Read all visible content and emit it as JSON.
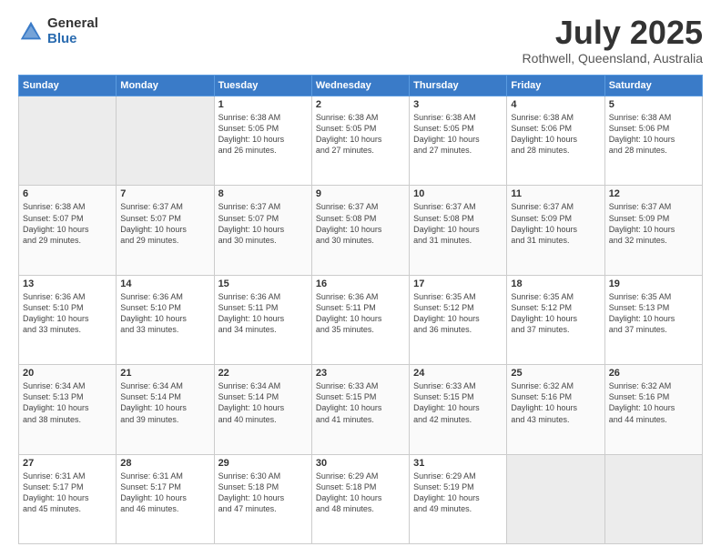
{
  "header": {
    "logo_general": "General",
    "logo_blue": "Blue",
    "month_title": "July 2025",
    "location": "Rothwell, Queensland, Australia"
  },
  "days_of_week": [
    "Sunday",
    "Monday",
    "Tuesday",
    "Wednesday",
    "Thursday",
    "Friday",
    "Saturday"
  ],
  "weeks": [
    [
      {
        "day": "",
        "info": ""
      },
      {
        "day": "",
        "info": ""
      },
      {
        "day": "1",
        "info": "Sunrise: 6:38 AM\nSunset: 5:05 PM\nDaylight: 10 hours\nand 26 minutes."
      },
      {
        "day": "2",
        "info": "Sunrise: 6:38 AM\nSunset: 5:05 PM\nDaylight: 10 hours\nand 27 minutes."
      },
      {
        "day": "3",
        "info": "Sunrise: 6:38 AM\nSunset: 5:05 PM\nDaylight: 10 hours\nand 27 minutes."
      },
      {
        "day": "4",
        "info": "Sunrise: 6:38 AM\nSunset: 5:06 PM\nDaylight: 10 hours\nand 28 minutes."
      },
      {
        "day": "5",
        "info": "Sunrise: 6:38 AM\nSunset: 5:06 PM\nDaylight: 10 hours\nand 28 minutes."
      }
    ],
    [
      {
        "day": "6",
        "info": "Sunrise: 6:38 AM\nSunset: 5:07 PM\nDaylight: 10 hours\nand 29 minutes."
      },
      {
        "day": "7",
        "info": "Sunrise: 6:37 AM\nSunset: 5:07 PM\nDaylight: 10 hours\nand 29 minutes."
      },
      {
        "day": "8",
        "info": "Sunrise: 6:37 AM\nSunset: 5:07 PM\nDaylight: 10 hours\nand 30 minutes."
      },
      {
        "day": "9",
        "info": "Sunrise: 6:37 AM\nSunset: 5:08 PM\nDaylight: 10 hours\nand 30 minutes."
      },
      {
        "day": "10",
        "info": "Sunrise: 6:37 AM\nSunset: 5:08 PM\nDaylight: 10 hours\nand 31 minutes."
      },
      {
        "day": "11",
        "info": "Sunrise: 6:37 AM\nSunset: 5:09 PM\nDaylight: 10 hours\nand 31 minutes."
      },
      {
        "day": "12",
        "info": "Sunrise: 6:37 AM\nSunset: 5:09 PM\nDaylight: 10 hours\nand 32 minutes."
      }
    ],
    [
      {
        "day": "13",
        "info": "Sunrise: 6:36 AM\nSunset: 5:10 PM\nDaylight: 10 hours\nand 33 minutes."
      },
      {
        "day": "14",
        "info": "Sunrise: 6:36 AM\nSunset: 5:10 PM\nDaylight: 10 hours\nand 33 minutes."
      },
      {
        "day": "15",
        "info": "Sunrise: 6:36 AM\nSunset: 5:11 PM\nDaylight: 10 hours\nand 34 minutes."
      },
      {
        "day": "16",
        "info": "Sunrise: 6:36 AM\nSunset: 5:11 PM\nDaylight: 10 hours\nand 35 minutes."
      },
      {
        "day": "17",
        "info": "Sunrise: 6:35 AM\nSunset: 5:12 PM\nDaylight: 10 hours\nand 36 minutes."
      },
      {
        "day": "18",
        "info": "Sunrise: 6:35 AM\nSunset: 5:12 PM\nDaylight: 10 hours\nand 37 minutes."
      },
      {
        "day": "19",
        "info": "Sunrise: 6:35 AM\nSunset: 5:13 PM\nDaylight: 10 hours\nand 37 minutes."
      }
    ],
    [
      {
        "day": "20",
        "info": "Sunrise: 6:34 AM\nSunset: 5:13 PM\nDaylight: 10 hours\nand 38 minutes."
      },
      {
        "day": "21",
        "info": "Sunrise: 6:34 AM\nSunset: 5:14 PM\nDaylight: 10 hours\nand 39 minutes."
      },
      {
        "day": "22",
        "info": "Sunrise: 6:34 AM\nSunset: 5:14 PM\nDaylight: 10 hours\nand 40 minutes."
      },
      {
        "day": "23",
        "info": "Sunrise: 6:33 AM\nSunset: 5:15 PM\nDaylight: 10 hours\nand 41 minutes."
      },
      {
        "day": "24",
        "info": "Sunrise: 6:33 AM\nSunset: 5:15 PM\nDaylight: 10 hours\nand 42 minutes."
      },
      {
        "day": "25",
        "info": "Sunrise: 6:32 AM\nSunset: 5:16 PM\nDaylight: 10 hours\nand 43 minutes."
      },
      {
        "day": "26",
        "info": "Sunrise: 6:32 AM\nSunset: 5:16 PM\nDaylight: 10 hours\nand 44 minutes."
      }
    ],
    [
      {
        "day": "27",
        "info": "Sunrise: 6:31 AM\nSunset: 5:17 PM\nDaylight: 10 hours\nand 45 minutes."
      },
      {
        "day": "28",
        "info": "Sunrise: 6:31 AM\nSunset: 5:17 PM\nDaylight: 10 hours\nand 46 minutes."
      },
      {
        "day": "29",
        "info": "Sunrise: 6:30 AM\nSunset: 5:18 PM\nDaylight: 10 hours\nand 47 minutes."
      },
      {
        "day": "30",
        "info": "Sunrise: 6:29 AM\nSunset: 5:18 PM\nDaylight: 10 hours\nand 48 minutes."
      },
      {
        "day": "31",
        "info": "Sunrise: 6:29 AM\nSunset: 5:19 PM\nDaylight: 10 hours\nand 49 minutes."
      },
      {
        "day": "",
        "info": ""
      },
      {
        "day": "",
        "info": ""
      }
    ]
  ]
}
